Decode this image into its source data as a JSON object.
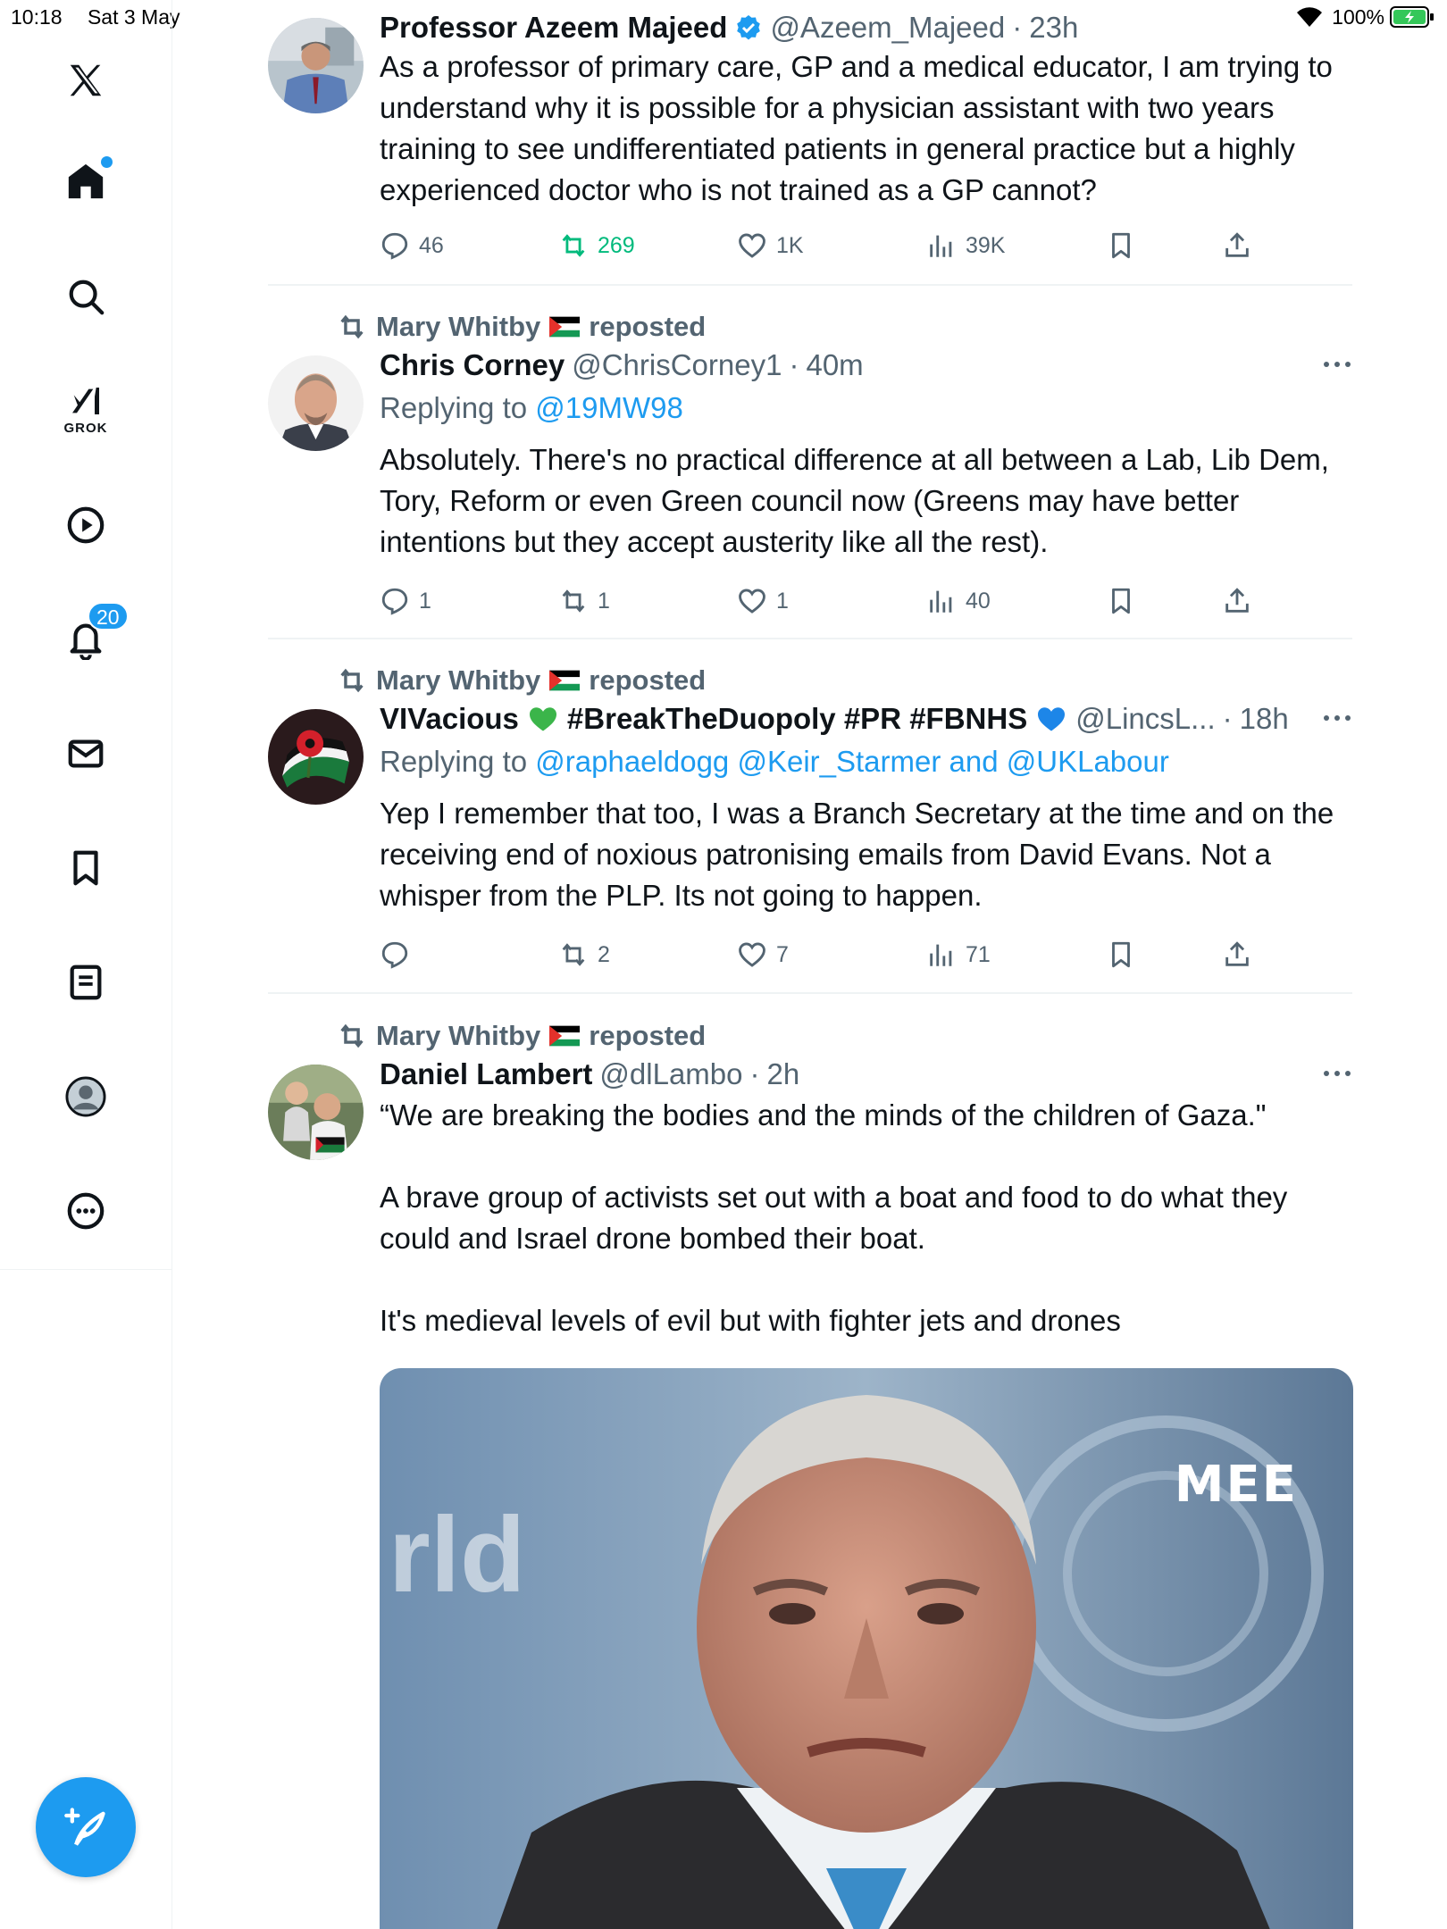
{
  "status_bar": {
    "time": "10:18",
    "date": "Sat 3 May",
    "battery": "100%"
  },
  "sidebar": {
    "grok_label": "GROK",
    "notifications_badge": "20"
  },
  "tweets": [
    {
      "author": "Professor Azeem Majeed",
      "handle": "@Azeem_Majeed",
      "time": "23h",
      "body": "As a professor of primary care, GP and a medical educator, I am trying to understand why it is possible for a physician assistant with two years training to see undifferentiated patients in general practice but a highly experienced doctor who is not trained as a GP cannot?",
      "replies": "46",
      "reposts": "269",
      "likes": "1K",
      "views": "39K"
    },
    {
      "reposted_by": "Mary Whitby",
      "reposted_label": "reposted",
      "author": "Chris Corney",
      "handle": "@ChrisCorney1",
      "time": "40m",
      "replying_label": "Replying to",
      "replying_to": "@19MW98",
      "body": "Absolutely.  There's no practical difference at all between a Lab, Lib Dem, Tory, Reform or even Green council now (Greens may have better intentions but they accept austerity like all the rest).",
      "replies": "1",
      "reposts": "1",
      "likes": "1",
      "views": "40"
    },
    {
      "reposted_by": "Mary Whitby",
      "reposted_label": "reposted",
      "author_part1": "VIVacious",
      "author_part2": "#BreakTheDuopoly #PR #FBNHS",
      "handle": "@LincsL...",
      "time": "18h",
      "replying_label": "Replying to",
      "replying_to_1": "@raphaeldogg",
      "replying_to_2": "@Keir_Starmer",
      "replying_and": "and",
      "replying_to_3": "@UKLabour",
      "body": "Yep I remember that too, I was a Branch Secretary at the time and on the receiving end of noxious patronising emails from David Evans. Not a whisper from the PLP. Its not going to happen.",
      "replies": "",
      "reposts": "2",
      "likes": "7",
      "views": "71"
    },
    {
      "reposted_by": "Mary Whitby",
      "reposted_label": "reposted",
      "author": "Daniel Lambert",
      "handle": "@dlLambo",
      "time": "2h",
      "body_1": "“We are breaking the bodies and the minds of the children of Gaza.\"",
      "body_2": "A brave group of activists set out with a boat and food to do what they could and Israel drone bombed their boat.",
      "body_3": "It's medieval levels of evil but with fighter jets and drones",
      "media_logo": "MEE"
    }
  ]
}
